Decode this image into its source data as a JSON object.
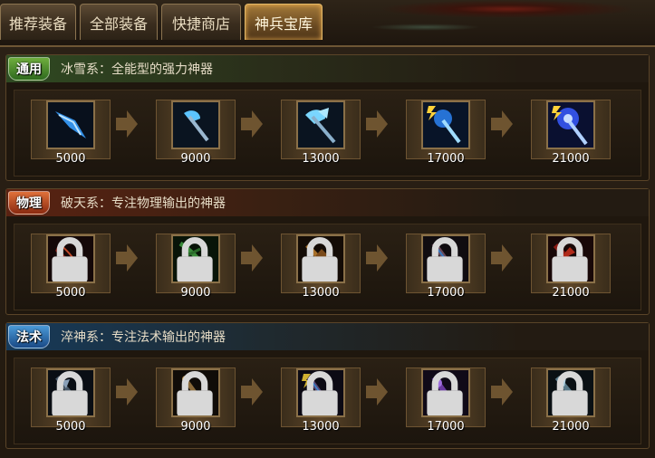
{
  "tabs": [
    {
      "label": "推荐装备"
    },
    {
      "label": "全部装备"
    },
    {
      "label": "快捷商店"
    },
    {
      "label": "神兵宝库",
      "active": true
    }
  ],
  "sections": [
    {
      "badge": "通用",
      "badge_color": "#4f8e30",
      "description": "冰雪系：全能型的强力神器",
      "items": [
        {
          "icon": "ice-shard-icon",
          "price": "5000",
          "locked": false
        },
        {
          "icon": "ice-axe-icon",
          "price": "9000",
          "locked": false
        },
        {
          "icon": "ice-double-axe-icon",
          "price": "13000",
          "locked": false
        },
        {
          "icon": "lightning-ice-staff-icon",
          "price": "17000",
          "locked": false
        },
        {
          "icon": "lightning-ice-scepter-icon",
          "price": "21000",
          "locked": false
        }
      ]
    },
    {
      "badge": "物理",
      "badge_color": "#b8481e",
      "description": "破天系：专注物理输出的神器",
      "items": [
        {
          "icon": "crimson-blade-icon",
          "price": "5000",
          "locked": true
        },
        {
          "icon": "jade-claw-icon",
          "price": "9000",
          "locked": true
        },
        {
          "icon": "flame-wing-blade-icon",
          "price": "13000",
          "locked": true
        },
        {
          "icon": "storm-sword-icon",
          "price": "17000",
          "locked": true
        },
        {
          "icon": "blood-wing-blade-icon",
          "price": "21000",
          "locked": true
        }
      ]
    },
    {
      "badge": "法术",
      "badge_color": "#2a6aac",
      "description": "淬神系：专注法术输出的神器",
      "items": [
        {
          "icon": "shadow-spear-icon",
          "price": "5000",
          "locked": true
        },
        {
          "icon": "bronze-rod-icon",
          "price": "9000",
          "locked": true
        },
        {
          "icon": "arcane-staff-icon",
          "price": "13000",
          "locked": true
        },
        {
          "icon": "violet-staff-icon",
          "price": "17000",
          "locked": true
        },
        {
          "icon": "frost-lance-icon",
          "price": "21000",
          "locked": true
        }
      ]
    }
  ]
}
